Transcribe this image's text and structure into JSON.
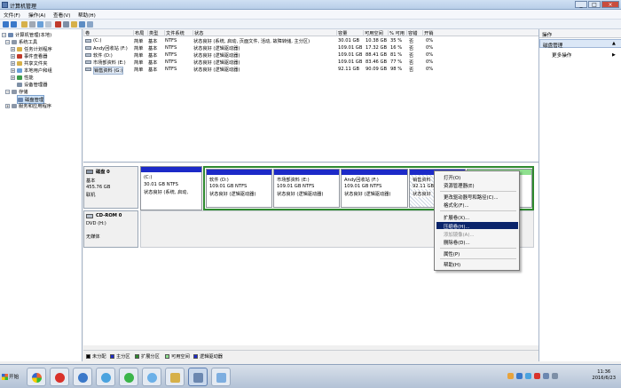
{
  "window": {
    "title": "计算机管理",
    "controls": [
      "_",
      "□",
      "×"
    ]
  },
  "menu": [
    "文件(F)",
    "操作(A)",
    "查看(V)",
    "帮助(H)"
  ],
  "tree": {
    "root": "计算机管理(本地)",
    "system_tools": "系统工具",
    "items": [
      "任务计划程序",
      "事件查看器",
      "共享文件夹",
      "本地用户和组",
      "性能",
      "设备管理器"
    ],
    "storage": "存储",
    "disk_mgmt": "磁盘管理",
    "services": "服务和应用程序"
  },
  "volume_list": {
    "headers": [
      "卷",
      "布局",
      "类型",
      "文件系统",
      "状态",
      "容量",
      "可用空间",
      "% 可用",
      "容错",
      "开销"
    ],
    "rows": [
      [
        "(C:)",
        "简单",
        "基本",
        "NTFS",
        "状态良好 (系统, 启动, 页面文件, 活动, 故障转储, 主分区)",
        "30.01 GB",
        "10.38 GB",
        "35 %",
        "否",
        "0%"
      ],
      [
        "Andy回收站 (F:)",
        "简单",
        "基本",
        "NTFS",
        "状态良好 (逻辑驱动器)",
        "109.01 GB",
        "17.32 GB",
        "16 %",
        "否",
        "0%"
      ],
      [
        "软件 (D:)",
        "简单",
        "基本",
        "NTFS",
        "状态良好 (逻辑驱动器)",
        "109.01 GB",
        "88.41 GB",
        "81 %",
        "否",
        "0%"
      ],
      [
        "市场部资料 (E:)",
        "简单",
        "基本",
        "NTFS",
        "状态良好 (逻辑驱动器)",
        "109.01 GB",
        "83.46 GB",
        "77 %",
        "否",
        "0%"
      ],
      [
        "销售资料 (G:)",
        "简单",
        "基本",
        "NTFS",
        "状态良好 (逻辑驱动器)",
        "92.11 GB",
        "90.09 GB",
        "98 %",
        "否",
        "0%"
      ]
    ]
  },
  "disk0": {
    "name": "磁盘 0",
    "type": "基本",
    "size": "455.76 GB",
    "status": "联机"
  },
  "partitions": [
    {
      "name": "(C:)",
      "size": "30.01 GB NTFS",
      "status": "状态良好 (系统, 启动,"
    },
    {
      "name": "软件 (D:)",
      "size": "109.01 GB NTFS",
      "status": "状态良好 (逻辑驱动器)"
    },
    {
      "name": "市场部资料 (E:)",
      "size": "109.01 GB NTFS",
      "status": "状态良好 (逻辑驱动器)"
    },
    {
      "name": "Andy回收站 (F:)",
      "size": "109.01 GB NTFS",
      "status": "状态良好 (逻辑驱动器)"
    },
    {
      "name": "销售资料",
      "size": "92.11 GB",
      "status": "状态良好"
    }
  ],
  "cdrom": {
    "name": "CD-ROM 0",
    "type": "DVD (H:)",
    "status": "无媒体"
  },
  "context_menu": [
    "打开(O)",
    "资源管理器(E)",
    "更改驱动器号和路径(C)...",
    "格式化(F)...",
    "扩展卷(X)...",
    "压缩卷(H)...",
    "添加镜像(A)...",
    "删除卷(D)...",
    "属性(P)",
    "帮助(H)"
  ],
  "context_disabled": [
    6
  ],
  "context_hover": 5,
  "legend": [
    "未分配",
    "主分区",
    "扩展分区",
    "可用空间",
    "逻辑驱动器"
  ],
  "legend_colors": [
    "#000000",
    "#1c2ac8",
    "#2f8a2f",
    "#8ee08e",
    "#1c2ac8"
  ],
  "actions": {
    "header": "操作",
    "section": "磁盘管理",
    "more": "更多操作"
  },
  "taskbar": {
    "start": "开始",
    "clock_time": "11:36",
    "clock_date": "2016/6/23"
  }
}
